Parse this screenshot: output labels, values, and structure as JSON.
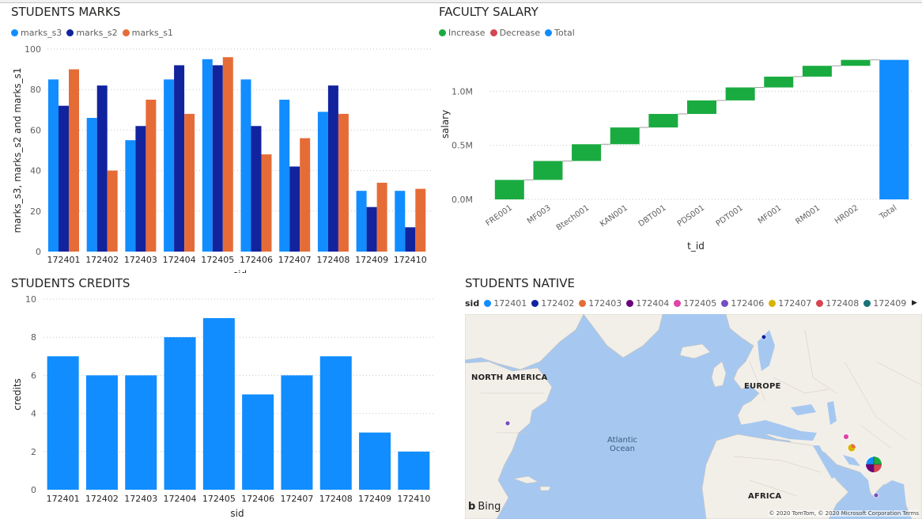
{
  "colors": {
    "marks_s3": "#118dff",
    "marks_s2": "#12239e",
    "marks_s1": "#e66c37",
    "increase": "#1aab40",
    "decrease": "#d64554",
    "total": "#118dff",
    "credits": "#118dff",
    "land": "#f2efe9",
    "water": "#a6c8f0"
  },
  "marks": {
    "title": "STUDENTS MARKS",
    "legend": [
      "marks_s3",
      "marks_s2",
      "marks_s1"
    ],
    "ylabel": "marks_s3, marks_s2 and marks_s1",
    "xlabel": "sid",
    "yticks": [
      "0",
      "20",
      "40",
      "60",
      "80",
      "100"
    ]
  },
  "salary": {
    "title": "FACULTY SALARY",
    "legend": [
      "Increase",
      "Decrease",
      "Total"
    ],
    "ylabel": "salary",
    "xlabel": "t_id",
    "yticks": [
      "0.0M",
      "0.5M",
      "1.0M"
    ]
  },
  "credits": {
    "title": "STUDENTS CREDITS",
    "ylabel": "credits",
    "xlabel": "sid",
    "yticks": [
      "0",
      "2",
      "4",
      "6",
      "8",
      "10"
    ]
  },
  "native": {
    "title": "STUDENTS NATIVE",
    "legend_title": "sid",
    "legend": [
      {
        "label": "172401",
        "color": "#118dff"
      },
      {
        "label": "172402",
        "color": "#12239e"
      },
      {
        "label": "172403",
        "color": "#e66c37"
      },
      {
        "label": "172404",
        "color": "#6b007b"
      },
      {
        "label": "172405",
        "color": "#e044a7"
      },
      {
        "label": "172406",
        "color": "#744ec2"
      },
      {
        "label": "172407",
        "color": "#d9b300"
      },
      {
        "label": "172408",
        "color": "#d64550"
      },
      {
        "label": "172409",
        "color": "#197278"
      }
    ],
    "region_labels": {
      "north_america": "NORTH AMERICA",
      "europe": "EUROPE",
      "africa": "AFRICA",
      "atlantic": "Atlantic",
      "ocean": "Ocean"
    },
    "bing": "Bing",
    "copyright": "© 2020 TomTom, © 2020 Microsoft Corporation",
    "terms": "Terms"
  },
  "chart_data": [
    {
      "type": "bar",
      "title": "STUDENTS MARKS",
      "xlabel": "sid",
      "ylabel": "marks_s3, marks_s2 and marks_s1",
      "ylim": [
        0,
        100
      ],
      "grid": true,
      "legend_position": "top-left",
      "categories": [
        "172401",
        "172402",
        "172403",
        "172404",
        "172405",
        "172406",
        "172407",
        "172408",
        "172409",
        "172410"
      ],
      "series": [
        {
          "name": "marks_s3",
          "values": [
            85,
            66,
            55,
            85,
            95,
            85,
            75,
            69,
            30,
            30
          ]
        },
        {
          "name": "marks_s2",
          "values": [
            72,
            82,
            62,
            92,
            92,
            62,
            42,
            82,
            22,
            12
          ]
        },
        {
          "name": "marks_s1",
          "values": [
            90,
            40,
            75,
            68,
            96,
            48,
            56,
            68,
            34,
            31
          ]
        }
      ]
    },
    {
      "type": "bar",
      "subtype": "waterfall",
      "title": "FACULTY SALARY",
      "xlabel": "t_id",
      "ylabel": "salary",
      "ylim": [
        0,
        1300000
      ],
      "grid": true,
      "legend_position": "top-left",
      "categories": [
        "FRE001",
        "MF003",
        "Btech001",
        "KAN001",
        "DBT001",
        "PDS001",
        "PDT001",
        "MF001",
        "RM001",
        "HR002",
        "Total"
      ],
      "values": [
        180000,
        175000,
        155000,
        155000,
        125000,
        125000,
        120000,
        100000,
        100000,
        55000,
        1290000
      ]
    },
    {
      "type": "bar",
      "title": "STUDENTS CREDITS",
      "xlabel": "sid",
      "ylabel": "credits",
      "ylim": [
        0,
        10
      ],
      "grid": true,
      "categories": [
        "172401",
        "172402",
        "172403",
        "172404",
        "172405",
        "172406",
        "172407",
        "172408",
        "172409",
        "172410"
      ],
      "values": [
        7,
        6,
        6,
        8,
        9,
        5,
        6,
        7,
        3,
        2
      ]
    }
  ]
}
